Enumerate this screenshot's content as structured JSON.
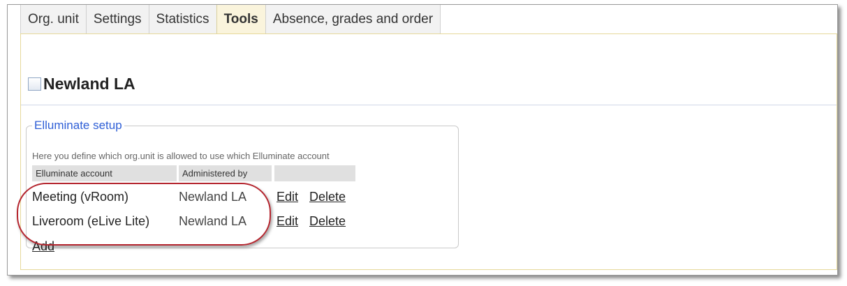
{
  "tabs": [
    {
      "label": "Org. unit"
    },
    {
      "label": "Settings"
    },
    {
      "label": "Statistics"
    },
    {
      "label": "Tools",
      "active": true
    },
    {
      "label": "Absence, grades and order"
    }
  ],
  "page": {
    "title": "Newland LA"
  },
  "setup": {
    "legend": "Elluminate setup",
    "description": "Here you define which org.unit is allowed to use which Elluminate account",
    "columns": [
      "Elluminate account",
      "Administered by",
      ""
    ],
    "rows": [
      {
        "account": "Meeting (vRoom)",
        "admin": "Newland LA",
        "edit": "Edit",
        "delete": "Delete"
      },
      {
        "account": "Liveroom (eLive Lite)",
        "admin": "Newland LA",
        "edit": "Edit",
        "delete": "Delete"
      }
    ],
    "add_label": "Add"
  },
  "colors": {
    "active_tab": "#faf4dc",
    "legend": "#2f5fd6",
    "highlight": "#b5262f"
  }
}
